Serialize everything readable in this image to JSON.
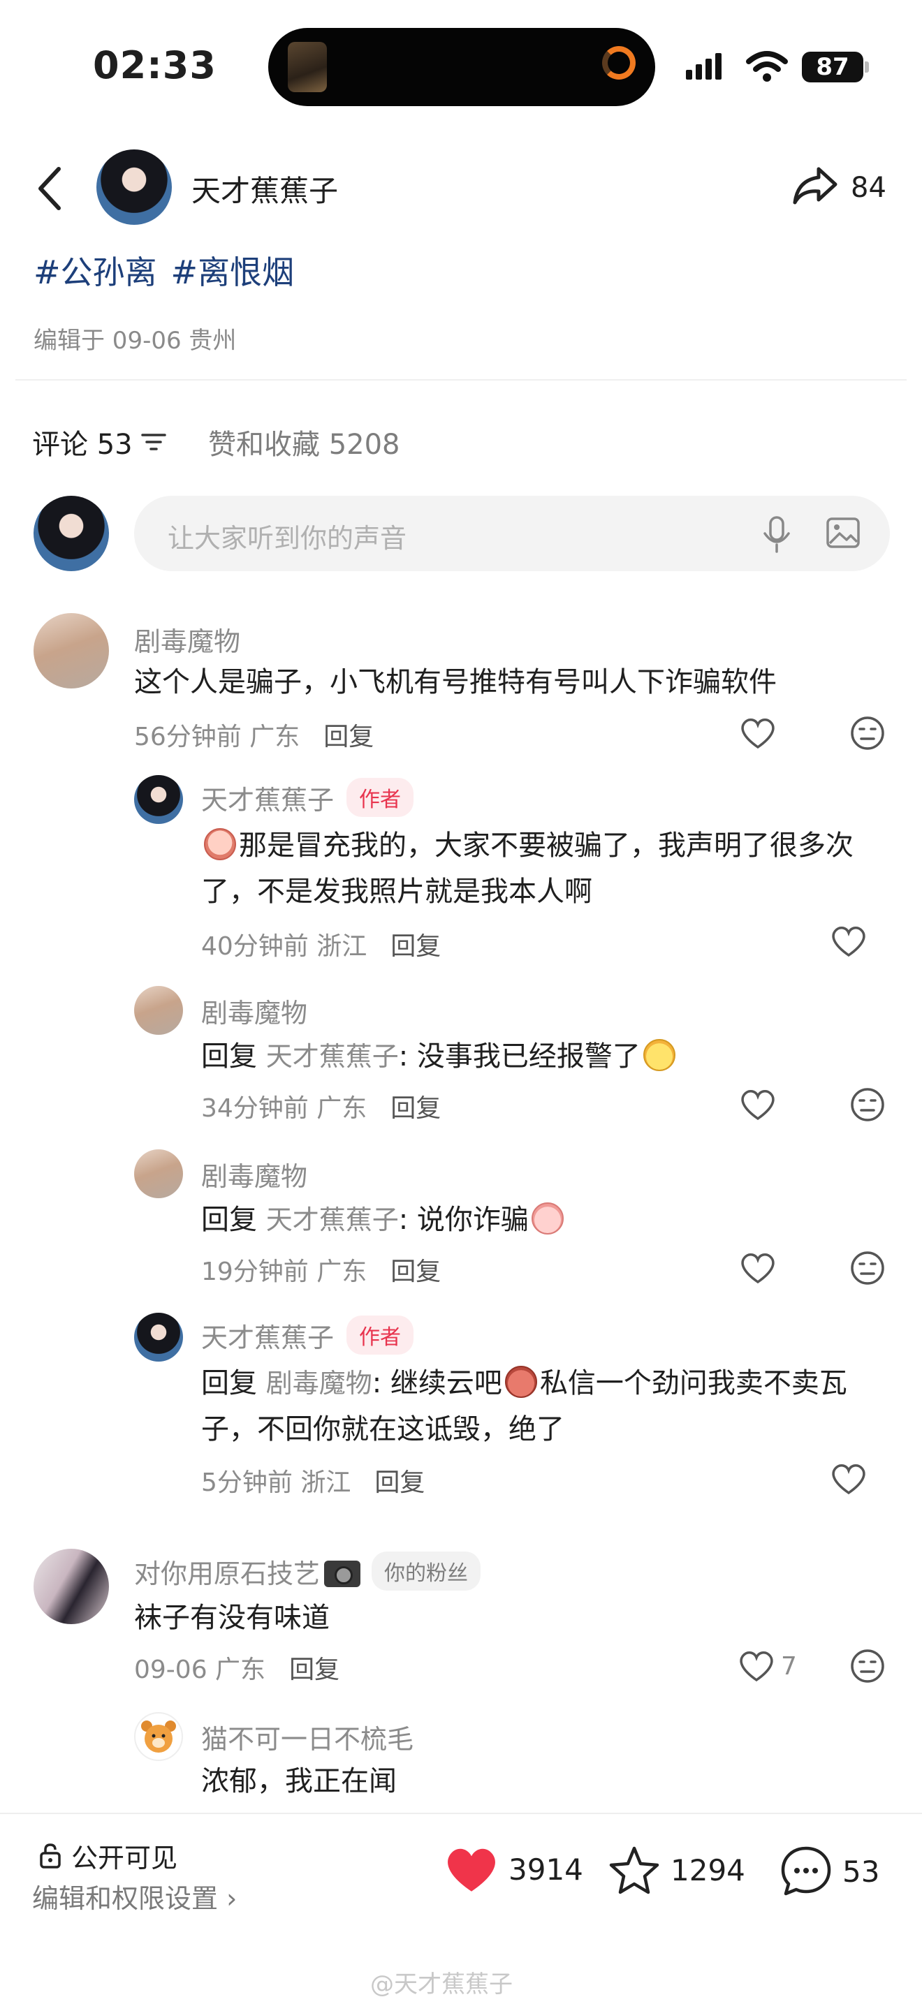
{
  "status_bar": {
    "time": "02:33",
    "battery": "87"
  },
  "header": {
    "title": "天才蕉蕉子",
    "share_count": "84"
  },
  "post": {
    "tags": [
      "#公孙离",
      "#离恨烟"
    ],
    "edited": "编辑于 09-06 贵州"
  },
  "tabs": {
    "comments": "评论 53",
    "likes": "赞和收藏 5208"
  },
  "input": {
    "placeholder": "让大家听到你的声音"
  },
  "comments": [
    {
      "name": "剧毒魔物",
      "text": "这个人是骗子，小飞机有号推特有号叫人下诈骗软件",
      "time": "56分钟前 广东",
      "reply": "回复"
    },
    {
      "name": "天才蕉蕉子",
      "badge": "作者",
      "text": "那是冒充我的，大家不要被骗了，我声明了很多次了，不是发我照片就是我本人啊",
      "time": "40分钟前 浙江",
      "reply": "回复"
    },
    {
      "name": "剧毒魔物",
      "reply_prefix": "回复",
      "reply_to": "天才蕉蕉子",
      "text": ": 没事我已经报警了",
      "time": "34分钟前 广东",
      "reply": "回复"
    },
    {
      "name": "剧毒魔物",
      "reply_prefix": "回复",
      "reply_to": "天才蕉蕉子",
      "text": ": 说你诈骗",
      "time": "19分钟前 广东",
      "reply": "回复"
    },
    {
      "name": "天才蕉蕉子",
      "badge": "作者",
      "reply_prefix": "回复",
      "reply_to": "剧毒魔物",
      "text_a": ": 继续云吧",
      "text_b": "私信一个劲问我卖不卖瓦子，不回你就在这诋毁，绝了",
      "time": "5分钟前 浙江",
      "reply": "回复"
    },
    {
      "name": "对你用原石技艺",
      "badge": "你的粉丝",
      "text": "袜子有没有味道",
      "time": "09-06 广东",
      "reply": "回复",
      "likes": "7"
    },
    {
      "name": "猫不可一日不梳毛",
      "text": "浓郁，我正在闻"
    }
  ],
  "bottom_bar": {
    "visibility": "公开可见",
    "permissions": "编辑和权限设置 ›",
    "likes": "3914",
    "favorites": "1294",
    "comments": "53",
    "watermark": "@天才蕉蕉子"
  },
  "colors": {
    "tag": "#1d3f7a",
    "like_red": "#f0344a",
    "author_badge": "#e8344e"
  },
  "icons": [
    "back-icon",
    "share-icon",
    "sort-icon",
    "mic-icon",
    "image-icon",
    "heart-icon",
    "dislike-face-icon",
    "lock-icon",
    "star-icon",
    "comment-icon"
  ]
}
